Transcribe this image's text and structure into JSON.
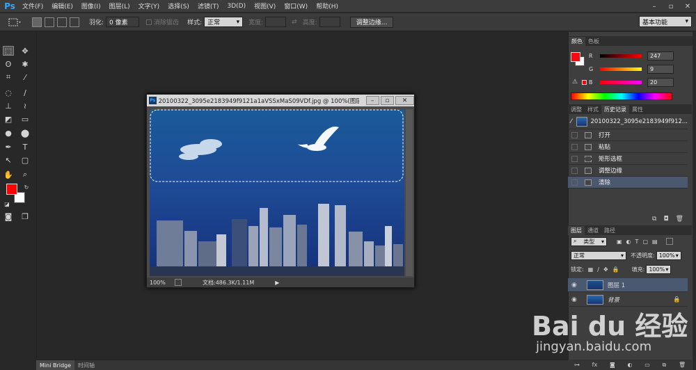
{
  "app": {
    "logo": "Ps"
  },
  "menu": [
    "文件(F)",
    "编辑(E)",
    "图像(I)",
    "图层(L)",
    "文字(Y)",
    "选择(S)",
    "滤镜(T)",
    "3D(D)",
    "视图(V)",
    "窗口(W)",
    "帮助(H)"
  ],
  "window_controls": {
    "minimize": "–",
    "restore": "▫",
    "close": "✕"
  },
  "options": {
    "feather_label": "羽化:",
    "feather_value": "0 像素",
    "antialias_label": "消除锯齿",
    "style_label": "样式:",
    "style_value": "正常",
    "width_label": "宽度:",
    "height_label": "高度:",
    "refine_edge_button": "调整边缘...",
    "workspace": "基本功能"
  },
  "document": {
    "title": "20100322_3095e2183949f9121a1aVSSxMaS09VDf.jpg @ 100%(图层 1...",
    "zoom": "100%",
    "doc_size": "文档:486.3K/1.11M"
  },
  "color_panel": {
    "tabs": [
      "颜色",
      "色板"
    ],
    "r_label": "R",
    "r_value": "247",
    "g_label": "G",
    "g_value": "9",
    "b_label": "B",
    "b_value": "20",
    "foreground": "#f70914",
    "background": "#ffffff"
  },
  "history_panel": {
    "tabs": [
      "调整",
      "样式",
      "历史记录",
      "属性"
    ],
    "snapshot": "20100322_3095e2183949f912...",
    "states": [
      "打开",
      "粘贴",
      "矩形选框",
      "调整边缘",
      "清除"
    ]
  },
  "layers_panel": {
    "tabs": [
      "图层",
      "通道",
      "路径"
    ],
    "filter_kind": "类型",
    "blend_mode": "正常",
    "opacity_label": "不透明度:",
    "opacity_value": "100%",
    "lock_label": "锁定:",
    "fill_label": "填充:",
    "fill_value": "100%",
    "layers": [
      "图层 1",
      "背景"
    ]
  },
  "bottom_tabs": [
    "Mini Bridge",
    "时间轴"
  ],
  "watermark": {
    "logo": "Bai du 经验",
    "url": "jingyan.baidu.com"
  },
  "colors": {
    "accent": "#31a8ff",
    "selected_row": "#4a5870"
  }
}
